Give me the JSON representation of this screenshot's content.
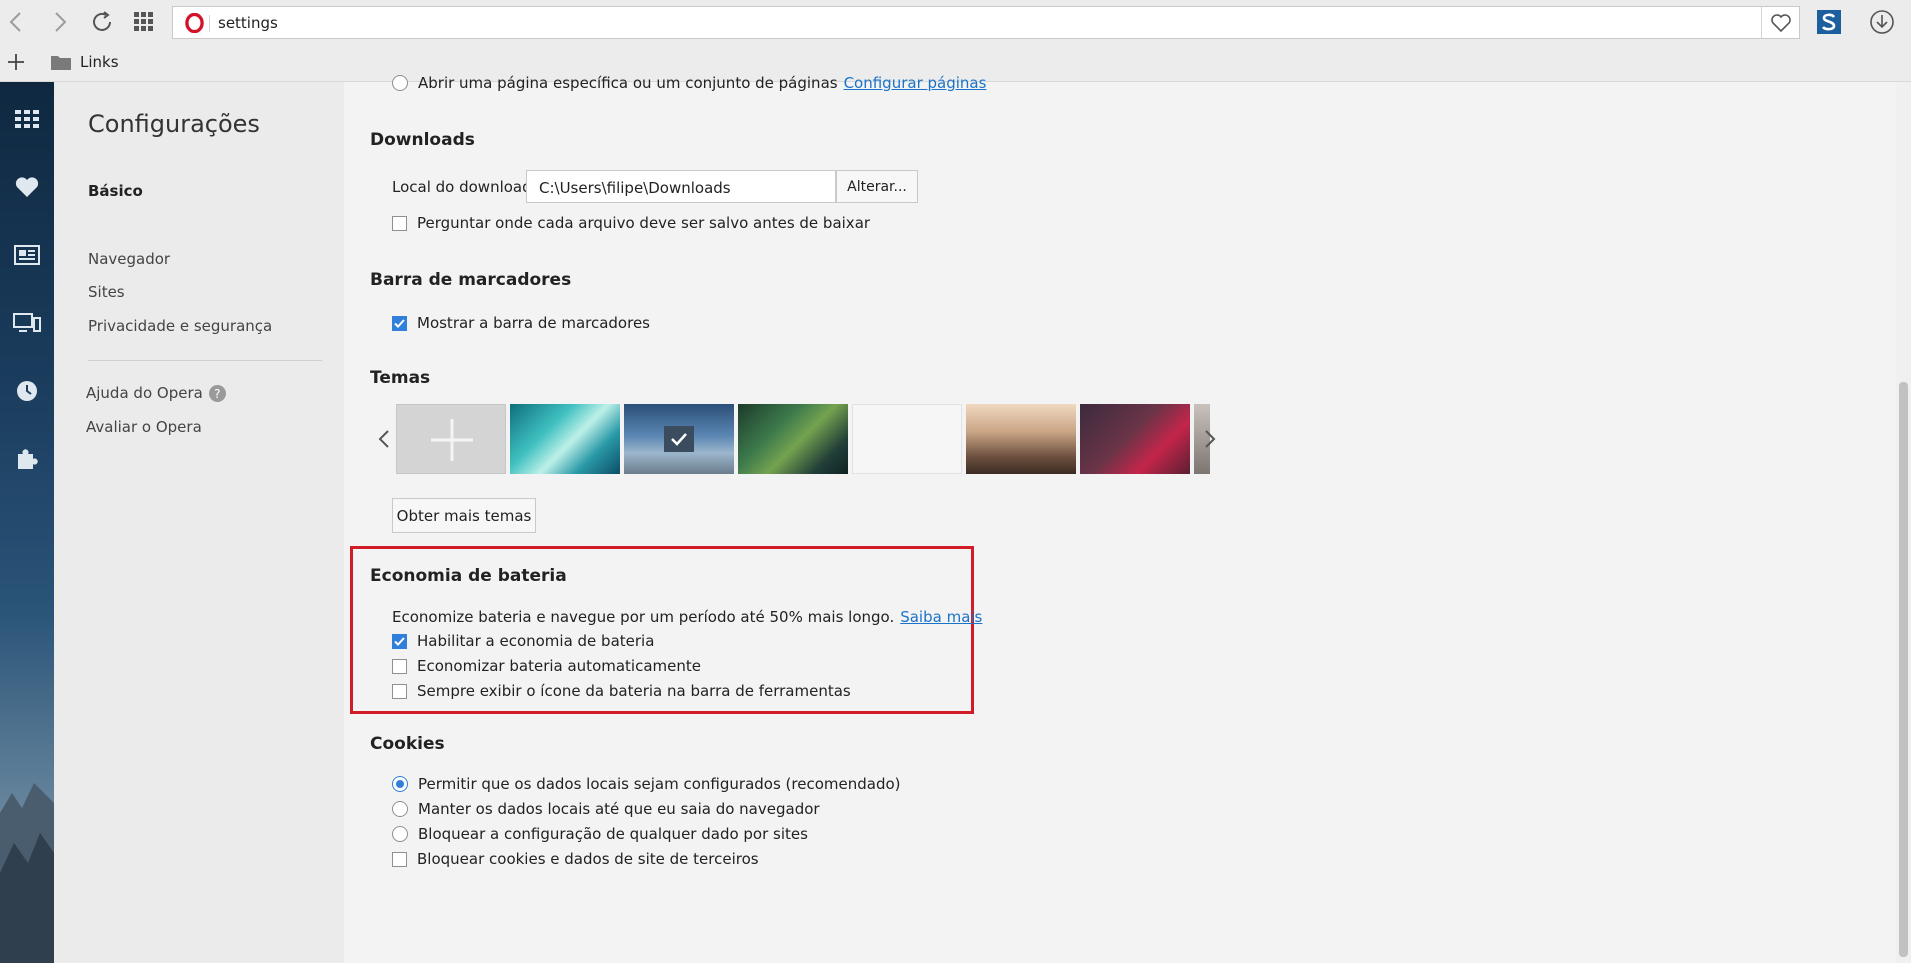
{
  "browser": {
    "address": "settings",
    "bookmark_folder": "Links"
  },
  "nav": {
    "title": "Configurações",
    "basic": "Básico",
    "items": [
      "Navegador",
      "Sites",
      "Privacidade e segurança"
    ],
    "help": "Ajuda do Opera",
    "rate": "Avaliar o Opera"
  },
  "startup": {
    "option_text": "Abrir uma página específica ou um conjunto de páginas",
    "option_link": "Configurar páginas"
  },
  "downloads": {
    "heading": "Downloads",
    "location_label": "Local do download:",
    "location_value": "C:\\Users\\filipe\\Downloads",
    "change_button": "Alterar...",
    "ask_label": "Perguntar onde cada arquivo deve ser salvo antes de baixar"
  },
  "bookmarks": {
    "heading": "Barra de marcadores",
    "show_label": "Mostrar a barra de marcadores"
  },
  "themes": {
    "heading": "Temas",
    "more_button": "Obter mais temas"
  },
  "battery": {
    "heading": "Economia de bateria",
    "description": "Economize bateria e navegue por um período até 50% mais longo.",
    "learn_more": "Saiba mais",
    "enable_label": "Habilitar a economia de bateria",
    "auto_label": "Economizar bateria automaticamente",
    "icon_label": "Sempre exibir o ícone da bateria na barra de ferramentas"
  },
  "cookies": {
    "heading": "Cookies",
    "allow_label": "Permitir que os dados locais sejam configurados (recomendado)",
    "keep_label": "Manter os dados locais até que eu saia do navegador",
    "block_label": "Bloquear a configuração de qualquer dado por sites",
    "third_party_label": "Bloquear cookies e dados de site de terceiros"
  },
  "colors": {
    "accent": "#2f7fdb",
    "highlight": "#d11b27",
    "link": "#1a73c8"
  }
}
